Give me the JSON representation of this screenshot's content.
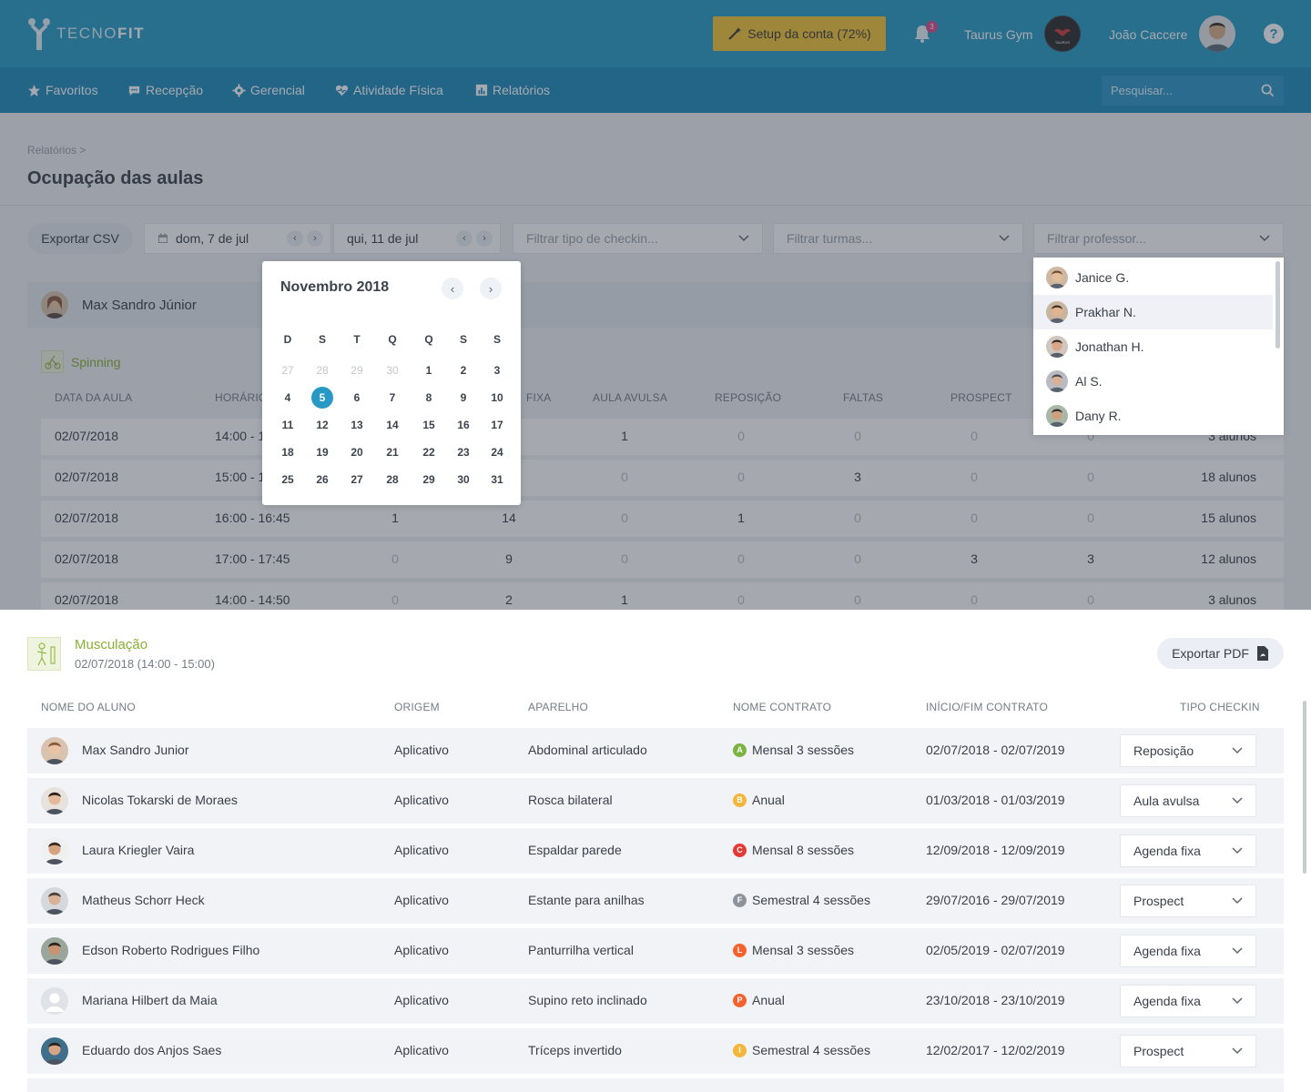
{
  "header": {
    "brand_light": "TECNO",
    "brand_bold": "FIT",
    "setup_label": "Setup da conta (72%)",
    "notifications_count": "3",
    "gym_name": "Taurus Gym",
    "gym_logo_text": "TAURUS",
    "user_name": "João Caccere",
    "help_label": "?"
  },
  "nav": {
    "items": [
      {
        "label": "Favoritos",
        "icon": "star-icon"
      },
      {
        "label": "Recepção",
        "icon": "chat-icon"
      },
      {
        "label": "Gerencial",
        "icon": "gear-icon"
      },
      {
        "label": "Atividade Física",
        "icon": "heart-pulse-icon"
      },
      {
        "label": "Relatórios",
        "icon": "chart-icon"
      }
    ],
    "search_placeholder": "Pesquisar..."
  },
  "page": {
    "breadcrumb": "Relatórios >",
    "title": "Ocupação das aulas"
  },
  "toolbar": {
    "export_csv": "Exportar CSV",
    "date_start": "dom, 7 de jul",
    "date_end": "qui, 11 de jul",
    "filter_checkin": "Filtrar tipo de checkin...",
    "filter_turmas": "Filtrar turmas...",
    "filter_professor": "Filtrar professor..."
  },
  "calendar": {
    "month": "Novembro 2018",
    "dow": [
      "D",
      "S",
      "T",
      "Q",
      "Q",
      "S",
      "S"
    ],
    "weeks": [
      [
        {
          "d": "27",
          "m": true
        },
        {
          "d": "28",
          "m": true
        },
        {
          "d": "29",
          "m": true
        },
        {
          "d": "30",
          "m": true
        },
        {
          "d": "1"
        },
        {
          "d": "2"
        },
        {
          "d": "3"
        }
      ],
      [
        {
          "d": "4"
        },
        {
          "d": "5",
          "s": true
        },
        {
          "d": "6"
        },
        {
          "d": "7"
        },
        {
          "d": "8"
        },
        {
          "d": "9"
        },
        {
          "d": "10"
        }
      ],
      [
        {
          "d": "11"
        },
        {
          "d": "12"
        },
        {
          "d": "13"
        },
        {
          "d": "14"
        },
        {
          "d": "15"
        },
        {
          "d": "16"
        },
        {
          "d": "17"
        }
      ],
      [
        {
          "d": "18"
        },
        {
          "d": "19"
        },
        {
          "d": "20"
        },
        {
          "d": "21"
        },
        {
          "d": "22"
        },
        {
          "d": "23"
        },
        {
          "d": "24"
        }
      ],
      [
        {
          "d": "25"
        },
        {
          "d": "26"
        },
        {
          "d": "27"
        },
        {
          "d": "28"
        },
        {
          "d": "29"
        },
        {
          "d": "30"
        },
        {
          "d": "31"
        }
      ]
    ]
  },
  "professors": [
    "Janice G.",
    "Prakhar N.",
    "Jonathan H.",
    "Al S.",
    "Dany R."
  ],
  "report": {
    "teacher": "Max Sandro Júnior",
    "class_name": "Spinning",
    "headers": [
      "DATA DA AULA",
      "HORÁRIO",
      "FIXA",
      "AULA AVULSA",
      "REPOSIÇÃO",
      "FALTAS",
      "PROSPECT"
    ],
    "rows": [
      {
        "date": "02/07/2018",
        "time": "14:00 - 1",
        "c1": "",
        "c2": "",
        "c3": "1",
        "c4": "0",
        "c5": "0",
        "c6": "0",
        "c7": "0",
        "total": "3 alunos"
      },
      {
        "date": "02/07/2018",
        "time": "15:00 - 1",
        "c1": "",
        "c2": "",
        "c3": "0",
        "c4": "0",
        "c5": "3",
        "c6": "0",
        "c7": "0",
        "total": "18 alunos"
      },
      {
        "date": "02/07/2018",
        "time": "16:00 - 16:45",
        "c1": "1",
        "c2": "14",
        "c3": "0",
        "c4": "1",
        "c5": "0",
        "c6": "0",
        "c7": "0",
        "total": "15 alunos"
      },
      {
        "date": "02/07/2018",
        "time": "17:00 - 17:45",
        "c1": "0",
        "c2": "9",
        "c3": "0",
        "c4": "0",
        "c5": "0",
        "c6": "3",
        "c7": "3",
        "total": "12 alunos"
      },
      {
        "date": "02/07/2018",
        "time": "14:00 - 14:50",
        "c1": "0",
        "c2": "2",
        "c3": "1",
        "c4": "0",
        "c5": "0",
        "c6": "0",
        "c7": "0",
        "total": "3 alunos"
      }
    ]
  },
  "detail": {
    "class_name": "Musculação",
    "class_sub": "02/07/2018 (14:00 - 15:00)",
    "export_pdf": "Exportar PDF",
    "headers": [
      "NOME DO ALUNO",
      "ORIGEM",
      "APARELHO",
      "NOME CONTRATO",
      "INÍCIO/FIM CONTRATO",
      "TIPO CHECKIN"
    ],
    "rows": [
      {
        "name": "Max Sandro Junior",
        "origin": "Aplicativo",
        "device": "Abdominal articulado",
        "badge": "A",
        "badge_color": "#7cb342",
        "contract": "Mensal 3 sessões",
        "period": "02/07/2018 - 02/07/2019",
        "checkin": "Reposição"
      },
      {
        "name": "Nicolas Tokarski de Moraes",
        "origin": "Aplicativo",
        "device": "Rosca bilateral",
        "badge": "B",
        "badge_color": "#f3b53a",
        "contract": "Anual",
        "period": "01/03/2018 - 01/03/2019",
        "checkin": "Aula avulsa"
      },
      {
        "name": "Laura Kriegler Vaira",
        "origin": "Aplicativo",
        "device": "Espaldar parede",
        "badge": "C",
        "badge_color": "#e53935",
        "contract": "Mensal 8 sessões",
        "period": "12/09/2018 - 12/09/2019",
        "checkin": "Agenda fixa"
      },
      {
        "name": "Matheus Schorr Heck",
        "origin": "Aplicativo",
        "device": "Estante para anilhas",
        "badge": "F",
        "badge_color": "#8e939b",
        "contract": "Semestral 4 sessões",
        "period": "29/07/2016 - 29/07/2019",
        "checkin": "Prospect"
      },
      {
        "name": "Edson Roberto Rodrigues Filho",
        "origin": "Aplicativo",
        "device": "Panturrilha vertical",
        "badge": "L",
        "badge_color": "#f4622d",
        "contract": "Mensal 3 sessões",
        "period": "02/05/2019 - 02/07/2019",
        "checkin": "Agenda fixa"
      },
      {
        "name": "Mariana Hilbert da Maia",
        "origin": "Aplicativo",
        "device": "Supino reto inclinado",
        "badge": "P",
        "badge_color": "#f4622d",
        "contract": "Anual",
        "period": "23/10/2018 - 23/10/2019",
        "checkin": "Agenda fixa"
      },
      {
        "name": "Eduardo dos Anjos Saes",
        "origin": "Aplicativo",
        "device": "Tríceps invertido",
        "badge": "I",
        "badge_color": "#f3b53a",
        "contract": "Semestral 4 sessões",
        "period": "12/02/2017 - 12/02/2019",
        "checkin": "Prospect"
      }
    ]
  }
}
